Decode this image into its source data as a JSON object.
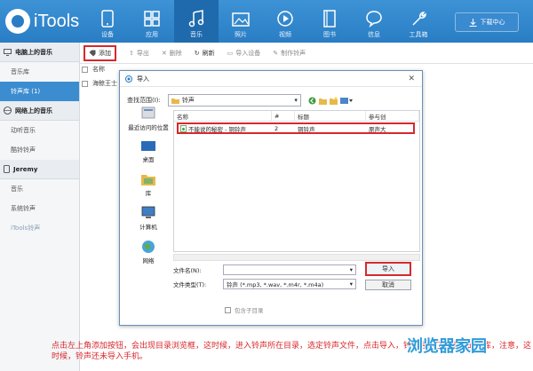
{
  "app": {
    "name": "iTools"
  },
  "nav": [
    {
      "label": "设备",
      "icon": "phone-icon"
    },
    {
      "label": "应用",
      "icon": "apps-icon"
    },
    {
      "label": "音乐",
      "icon": "music-icon",
      "active": true
    },
    {
      "label": "照片",
      "icon": "photo-icon"
    },
    {
      "label": "视频",
      "icon": "video-icon"
    },
    {
      "label": "图书",
      "icon": "book-icon"
    },
    {
      "label": "信息",
      "icon": "message-icon"
    },
    {
      "label": "工具箱",
      "icon": "toolbox-icon"
    }
  ],
  "download_center": "下载中心",
  "sidebar": {
    "group1": "电脑上的音乐",
    "group1_items": [
      "音乐库",
      "铃声库 (1)"
    ],
    "group2": "网络上的音乐",
    "group2_items": [
      "动听音乐",
      "酷铃铃声"
    ],
    "group3": "Jeremy",
    "group3_items": [
      "音乐",
      "系统铃声",
      "iTools铃声"
    ]
  },
  "toolbar": {
    "add": "添加",
    "export": "导出",
    "delete": "删除",
    "refresh": "刷新",
    "import_device": "导入设备",
    "make_ringtone": "制作铃声"
  },
  "list": {
    "header": "名称",
    "row1": "海鲸王士"
  },
  "dialog": {
    "title": "导入",
    "range_label": "查找范围(I):",
    "range_value": "铃声",
    "places": [
      "最近访问的位置",
      "桌面",
      "库",
      "计算机",
      "网络"
    ],
    "columns": [
      "名称",
      "#",
      "标题",
      "参与创"
    ],
    "file": {
      "name": "不能说的秘密 - 铜铃声",
      "num": "2",
      "title": "铜铃声",
      "artist": "原声大"
    },
    "filename_label": "文件名(N):",
    "filetype_label": "文件类型(T):",
    "filetype_value": "铃声 (*.mp3, *.wav, *.m4r, *.m4a)",
    "import_btn": "导入",
    "cancel_btn": "取消",
    "subfolder": "包含子目录"
  },
  "caption": "点击左上角添加按钮，会出现目录浏览框，这时候，进入铃声所在目录，选定铃声文件，点击导入，铃声导入了电脑上的仓库，注意，这时候，铃声还未导入手机。",
  "watermark": "浏览器家园"
}
